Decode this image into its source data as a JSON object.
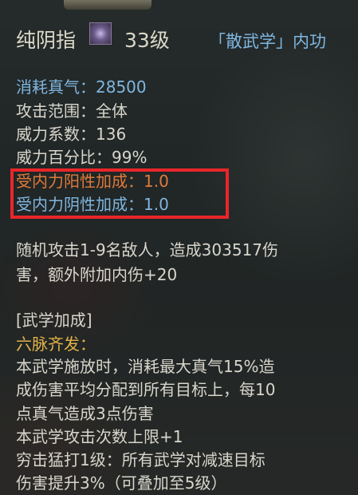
{
  "skill": {
    "name": "纯阴指",
    "level": "33级",
    "category": "「散武学」内功"
  },
  "stats": {
    "cost": "消耗真气：28500",
    "range": "攻击范围：全体",
    "power_coef": "威力系数：136",
    "power_pct": "威力百分比：99%",
    "yang_bonus": "受内力阳性加成：1.0",
    "yin_bonus": "受内力阴性加成：1.0"
  },
  "description": {
    "line1": "随机攻击1-9名敌人，造成303517伤",
    "line2": "害，额外附加内伤+20"
  },
  "bonus": {
    "header": "[武学加成]",
    "subheader": "六脉齐发：",
    "lines": [
      "本武学施放时，消耗最大真气15%造",
      "成伤害平均分配到所有目标上，每10",
      "点真气造成3点伤害",
      "本武学攻击次数上限+1",
      "穷击猛打1级：所有武学对减速目标",
      "伤害提升3%（可叠加至5级）"
    ]
  },
  "colors": {
    "blue_text": "#7fb6e0",
    "orange_text": "#e07a3a",
    "gold_text": "#e0b24a",
    "highlight_box": "#e8262a"
  }
}
